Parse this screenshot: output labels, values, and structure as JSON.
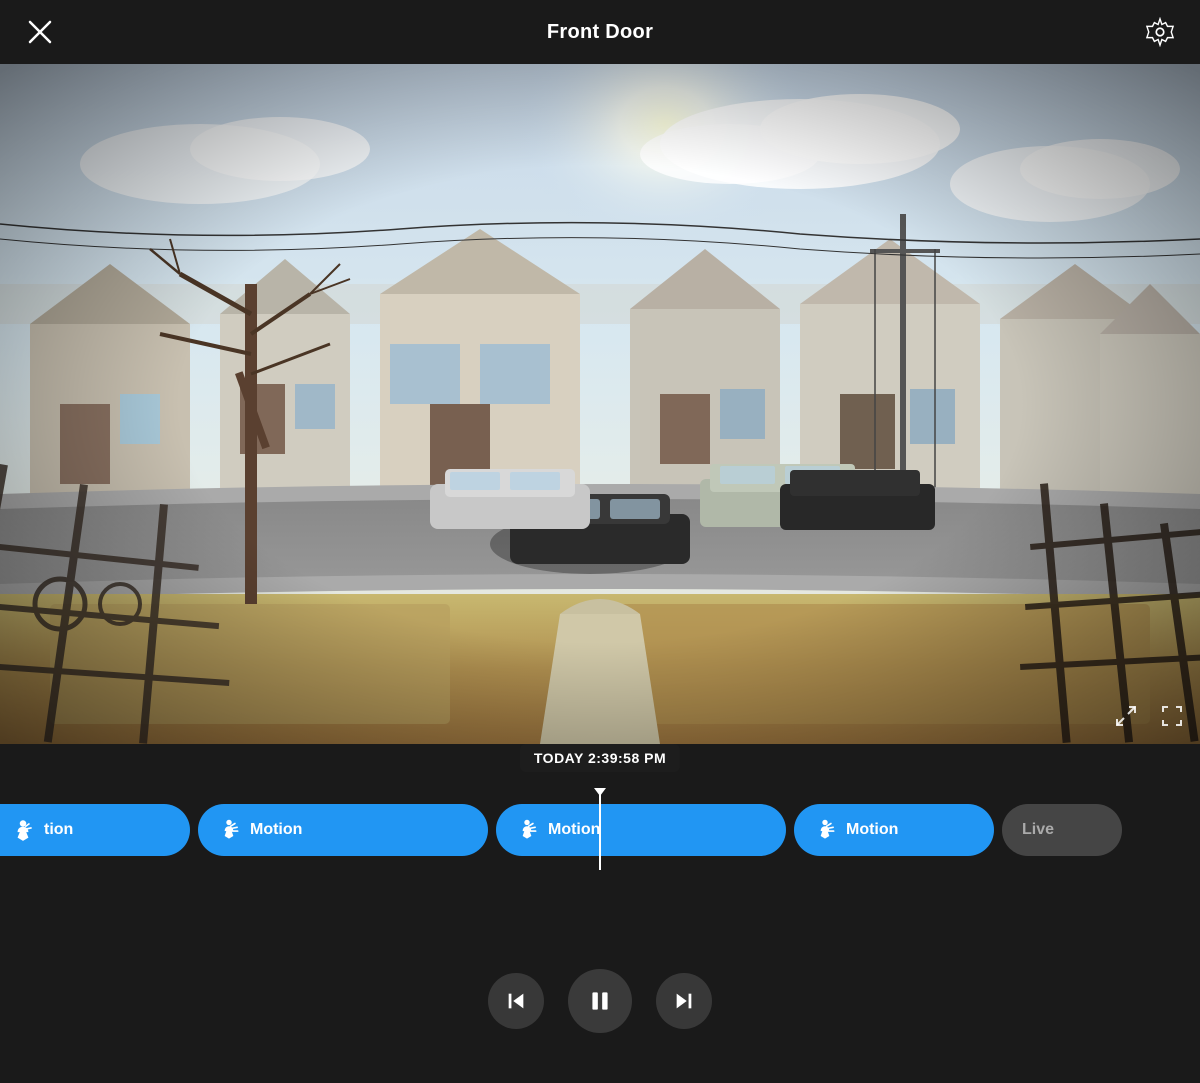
{
  "header": {
    "title": "Front Door",
    "close_label": "close",
    "settings_label": "settings"
  },
  "video": {
    "timestamp": "TODAY 2:39:58 PM"
  },
  "timeline": {
    "events": [
      {
        "id": "motion-partial",
        "label": "tion",
        "type": "partial"
      },
      {
        "id": "motion-1",
        "label": "Motion",
        "type": "motion"
      },
      {
        "id": "motion-2",
        "label": "Motion",
        "type": "motion"
      },
      {
        "id": "motion-3",
        "label": "Motion",
        "type": "motion"
      },
      {
        "id": "live",
        "label": "Live",
        "type": "live"
      }
    ]
  },
  "controls": {
    "prev_label": "previous",
    "pause_label": "pause",
    "next_label": "next"
  },
  "colors": {
    "background": "#1a1a1a",
    "accent_blue": "#2196F3",
    "white": "#ffffff",
    "ctrl_bg": "rgba(60,60,60,0.9)"
  }
}
